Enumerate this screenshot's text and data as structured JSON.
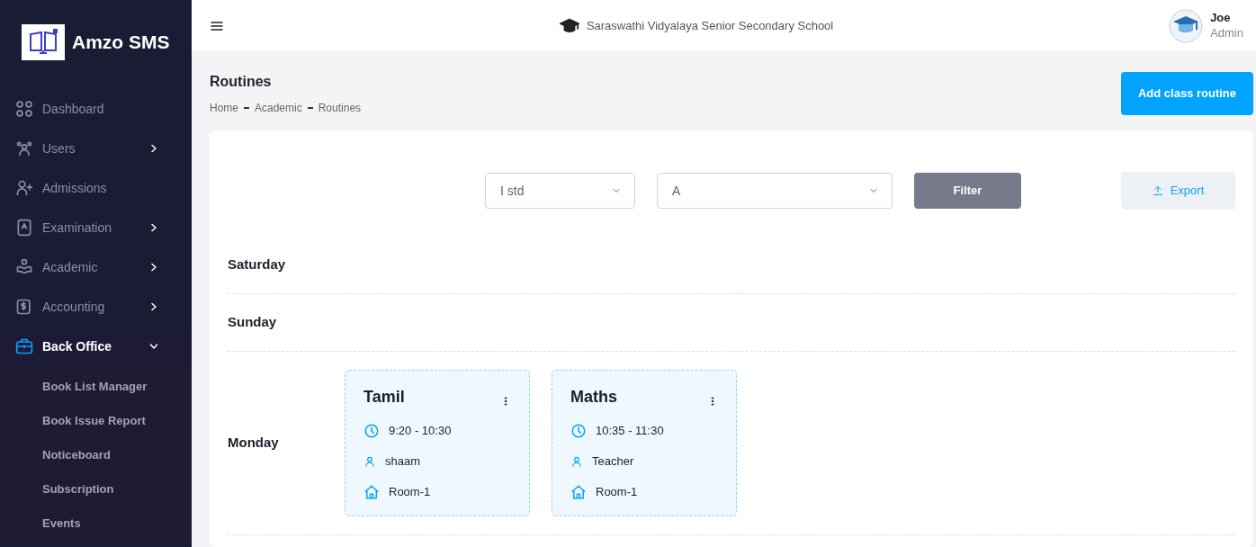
{
  "sidebar": {
    "brand": "Amzo SMS",
    "items": [
      {
        "label": "Dashboard",
        "has_submenu": false,
        "selected": false
      },
      {
        "label": "Users",
        "has_submenu": true,
        "selected": false,
        "expanded": false
      },
      {
        "label": "Admissions",
        "has_submenu": false,
        "selected": false
      },
      {
        "label": "Examination",
        "has_submenu": true,
        "selected": false,
        "expanded": false
      },
      {
        "label": "Academic",
        "has_submenu": true,
        "selected": false,
        "expanded": false
      },
      {
        "label": "Accounting",
        "has_submenu": true,
        "selected": false,
        "expanded": false
      },
      {
        "label": "Back Office",
        "has_submenu": true,
        "selected": true,
        "expanded": true,
        "children": [
          {
            "label": "Book List Manager"
          },
          {
            "label": "Book Issue Report"
          },
          {
            "label": "Noticeboard"
          },
          {
            "label": "Subscription"
          },
          {
            "label": "Events"
          }
        ]
      }
    ]
  },
  "header": {
    "school": "Saraswathi Vidyalaya Senior Secondary School",
    "user": {
      "name": "Joe",
      "role": "Admin"
    }
  },
  "page": {
    "title": "Routines",
    "breadcrumb": [
      "Home",
      "Academic",
      "Routines"
    ],
    "add_button": "Add class routine"
  },
  "filters": {
    "class": "I std",
    "section": "A",
    "filter_button": "Filter",
    "export_button": "Export"
  },
  "days": [
    {
      "day": "Saturday"
    },
    {
      "day": "Sunday"
    },
    {
      "day": "Monday",
      "routines": [
        {
          "subject": "Tamil",
          "time": "9:20 - 10:30",
          "teacher": "shaam",
          "room": "Room-1"
        },
        {
          "subject": "Maths",
          "time": "10:35 - 11:30",
          "teacher": "Teacher",
          "room": "Room-1"
        }
      ]
    }
  ]
}
